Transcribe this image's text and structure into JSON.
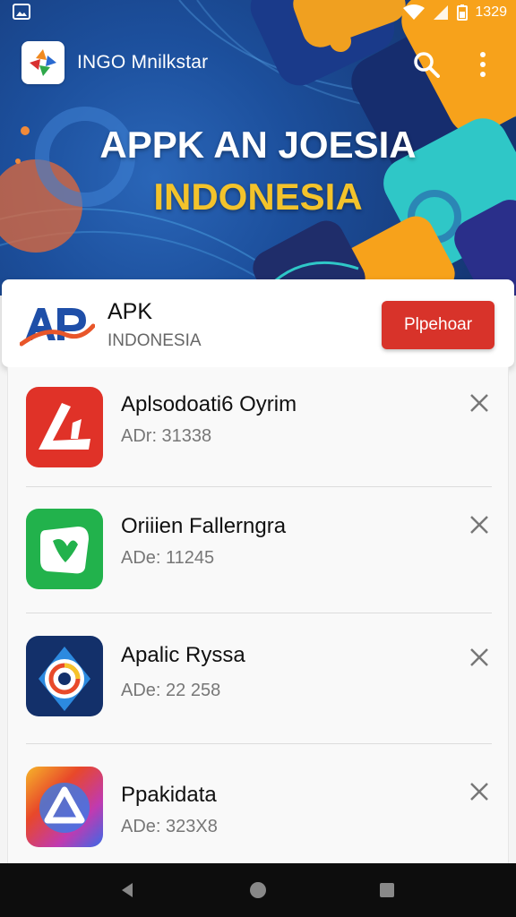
{
  "status": {
    "time": "1329"
  },
  "app": {
    "name": "INGO Mnilkstar"
  },
  "hero": {
    "title": "APPK AN JOESIA",
    "subtitle": "INDONESIA"
  },
  "featured": {
    "title": "APK",
    "subtitle": "INDONESIA",
    "button_label": "Plpehoar"
  },
  "apps": [
    {
      "name": "Aplsodoati6 Oyrim",
      "meta": "ADr: 31338",
      "icon": "red-app-icon"
    },
    {
      "name": "Oriiien Fallerngra",
      "meta": "ADe: 11245",
      "icon": "green-app-icon"
    },
    {
      "name": "Apalic Ryssa",
      "meta": "ADe: 22 258",
      "icon": "blue-app-icon"
    },
    {
      "name": "Ppakidata",
      "meta": "ADe: 323X8",
      "icon": "gradient-app-icon"
    }
  ],
  "colors": {
    "accent": "#d8332a",
    "hero_yellow": "#f3c32b",
    "hero_blue": "#1c4f9c"
  }
}
